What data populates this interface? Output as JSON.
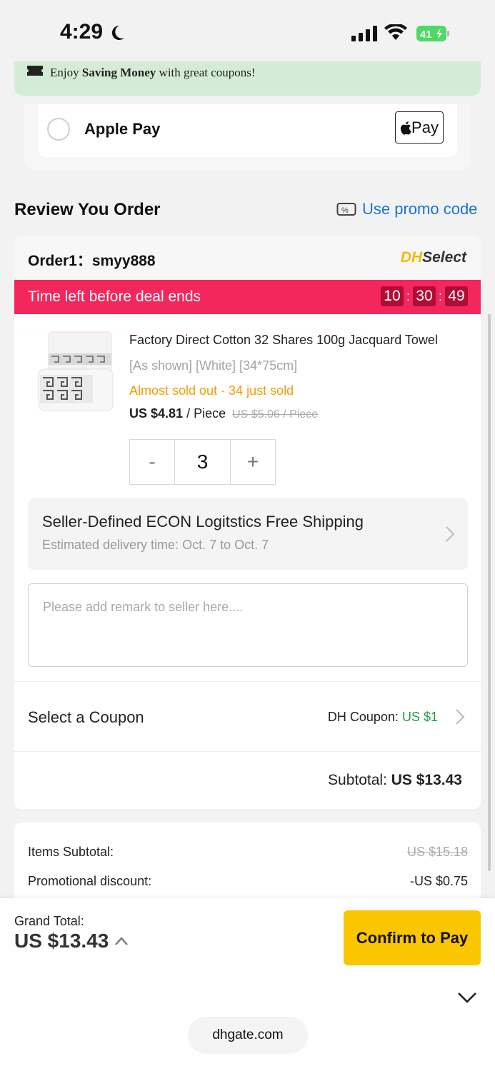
{
  "status_bar": {
    "time": "4:29",
    "battery": "41"
  },
  "banner": {
    "prefix": "Enjoy ",
    "bold": "Saving Money",
    "suffix": " with great coupons!"
  },
  "payment": {
    "label": "Apple Pay",
    "badge": "Pay"
  },
  "review": {
    "title": "Review You Order",
    "promo_link": "Use promo code"
  },
  "order": {
    "id_label": "Order1：smyy888",
    "badge_dh": "DH",
    "badge_select": "Select",
    "deal_text": "Time left before deal ends",
    "timer": {
      "hours": "10",
      "minutes": "30",
      "seconds": "49"
    },
    "product": {
      "title": "Factory Direct Cotton 32 Shares 100g Jacquard Towel",
      "variant": "[As shown] [White] [34*75cm]",
      "stock": "Almost sold out · 34 just sold",
      "price": "US $4.81",
      "unit": " / Piece",
      "old_price": "US $5.06 / Piece",
      "quantity": "3",
      "minus": "-",
      "plus": "+"
    },
    "shipping": {
      "title": "Seller-Defined ECON Logitstics Free Shipping",
      "subtitle": "Estimated delivery time: Oct. 7 to Oct. 7"
    },
    "remark_placeholder": "Please add remark to seller here....",
    "coupon": {
      "label": "Select a Coupon",
      "prefix": "DH Coupon: ",
      "amount": "US $1"
    },
    "subtotal": {
      "label": "Subtotal: ",
      "value": "US $13.43"
    }
  },
  "summary": {
    "items_label": "Items Subtotal:",
    "items_value": "US $15.18",
    "promo_label": "Promotional discount:",
    "promo_value": "-US $0.75"
  },
  "footer": {
    "grand_label": "Grand Total:",
    "grand_value": "US $13.43",
    "confirm": "Confirm to Pay",
    "url": "dhgate.com"
  },
  "colors": {
    "accent": "#f9c600",
    "deal_bar": "#f4275c",
    "link": "#1a73d6",
    "banner": "#d4ecd6"
  }
}
